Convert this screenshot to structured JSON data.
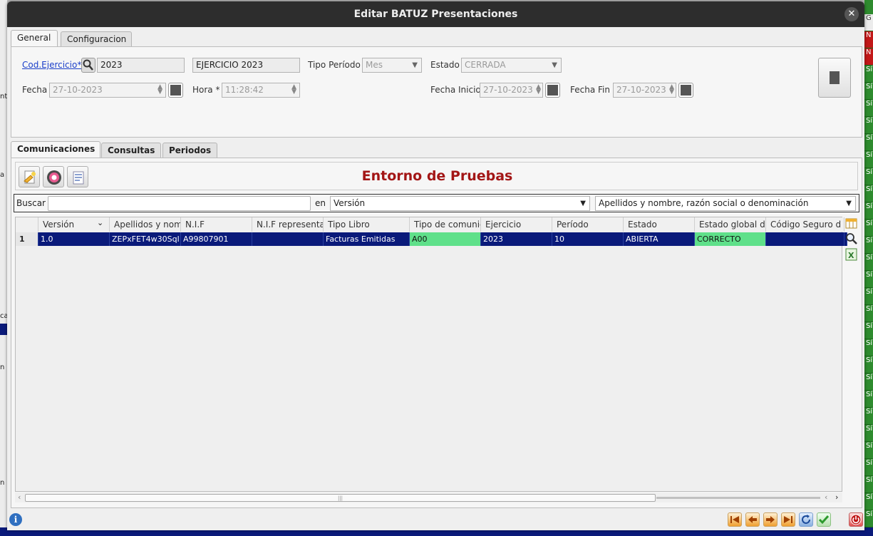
{
  "dialog": {
    "title": "Editar BATUZ Presentaciones",
    "close_glyph": "✕"
  },
  "top_tabs": [
    {
      "label": "General"
    },
    {
      "label": "Configuracion"
    }
  ],
  "form": {
    "cod_ejercicio_label": "Cod.Ejercicio*",
    "cod_ejercicio_value": "2023",
    "ejercicio_desc_value": "EJERCICIO 2023",
    "tipo_periodo_label": "Tipo Período",
    "tipo_periodo_value": "Mes",
    "estado_label": "Estado",
    "estado_value": "CERRADA",
    "fecha_label": "Fecha",
    "fecha_value": "27-10-2023",
    "hora_label": "Hora *",
    "hora_value": "11:28:42",
    "fecha_inicio_label": "Fecha Inicio",
    "fecha_inicio_value": "27-10-2023",
    "fecha_fin_label": "Fecha Fin",
    "fecha_fin_value": "27-10-2023"
  },
  "sub_tabs": [
    {
      "label": "Comunicaciones"
    },
    {
      "label": "Consultas"
    },
    {
      "label": "Periodos"
    }
  ],
  "banner": {
    "text": "Entorno de Pruebas",
    "color": "#a31616"
  },
  "search": {
    "label": "Buscar",
    "value": "",
    "in_label": "en",
    "field_select": "Versión",
    "order_select": "Apellidos y nombre, razón social o denominación"
  },
  "table": {
    "columns": [
      "Versión",
      "Apellidos y nom",
      "N.I.F",
      "N.I.F representa",
      "Tipo Libro",
      "Tipo de comunic",
      "Ejercicio",
      "Período",
      "Estado",
      "Estado global de",
      "Código Seguro d"
    ],
    "rows": [
      {
        "num": "1",
        "cells": [
          "1.0",
          "ZEPxFET4w30Sql",
          "A99807901",
          "",
          "Facturas Emitidas",
          "A00",
          "2023",
          "10",
          "ABIERTA",
          "CORRECTO",
          ""
        ]
      }
    ],
    "row_color": "#0a1a7a",
    "highlight_color": "#5fe08a"
  },
  "scroll": {
    "grip": "|||",
    "left": "‹",
    "right": "›"
  },
  "bg_right_cells": [
    "G",
    "N",
    "N",
    "Sí",
    "Sí",
    "Sí",
    "Sí",
    "Sí",
    "Sí",
    "Sí",
    "Sí",
    "Sí",
    "Sí",
    "Sí",
    "Sí",
    "Sí",
    "Sí",
    "Sí",
    "Sí",
    "Sí",
    "Sí",
    "Sí",
    "Sí",
    "Sí",
    "Sí",
    "Sí",
    "Sí",
    "Sí",
    "Sí",
    "Sí",
    "Sí"
  ],
  "bg_left_labels": [
    "nta",
    "a",
    "ca",
    "n",
    "n"
  ]
}
